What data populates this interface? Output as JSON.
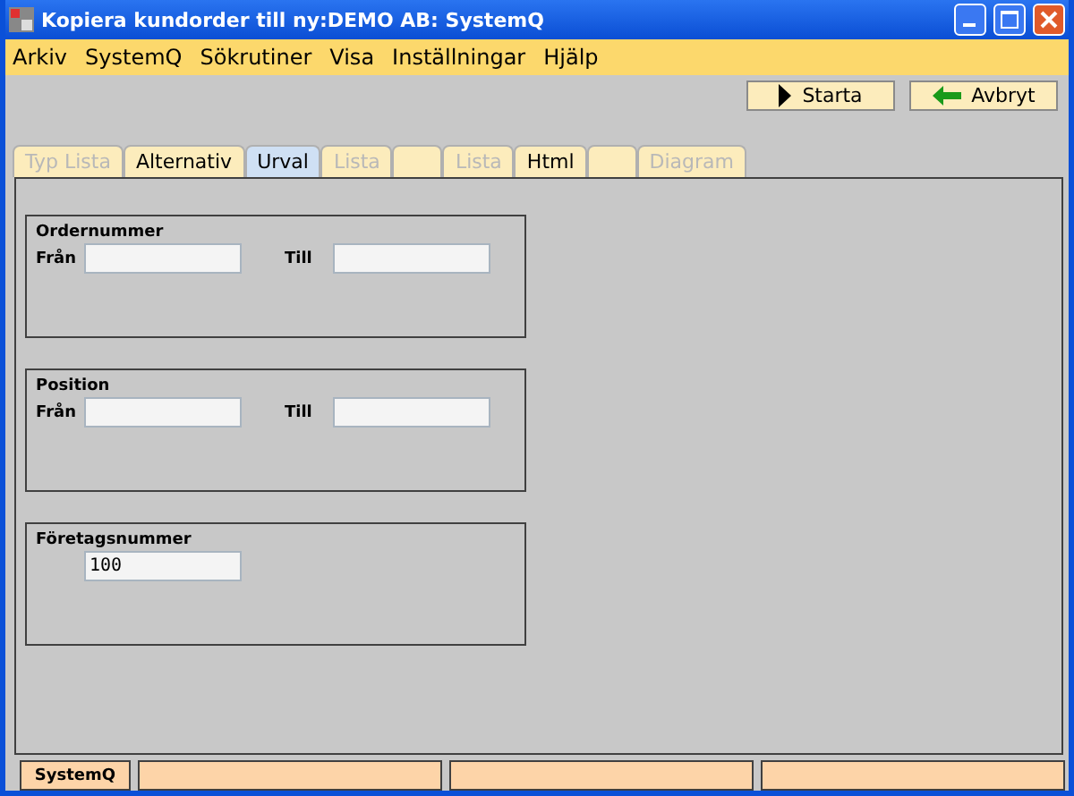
{
  "window": {
    "title": "Kopiera kundorder till ny:DEMO AB: SystemQ"
  },
  "menu": [
    "Arkiv",
    "SystemQ",
    "Sökrutiner",
    "Visa",
    "Inställningar",
    "Hjälp"
  ],
  "toolbar": [
    {
      "label": "Starta",
      "kind": "play"
    },
    {
      "label": "Avbryt",
      "kind": "back"
    }
  ],
  "tabs": [
    {
      "label": "Typ Lista",
      "selected": false,
      "disabled": true
    },
    {
      "label": "Alternativ",
      "selected": false,
      "disabled": false
    },
    {
      "label": "Urval",
      "selected": true,
      "disabled": false
    },
    {
      "label": "Lista",
      "selected": false,
      "disabled": true
    },
    {
      "selected": false
    },
    {
      "label": "Lista",
      "selected": false,
      "disabled": true
    },
    {
      "label": "Html",
      "selected": false,
      "disabled": false
    },
    {
      "selected": false
    },
    {
      "label": "Diagram",
      "selected": false,
      "disabled": true
    }
  ],
  "groups": [
    {
      "title": "Ordernummer",
      "kind": "range",
      "from_label": "Från",
      "to_label": "Till"
    },
    {
      "title": "Position",
      "kind": "range",
      "from_label": "Från",
      "to_label": "Till"
    },
    {
      "title": "Företagsnummer",
      "kind": "single",
      "value": "100"
    }
  ],
  "status_bar": [
    "SystemQ"
  ]
}
